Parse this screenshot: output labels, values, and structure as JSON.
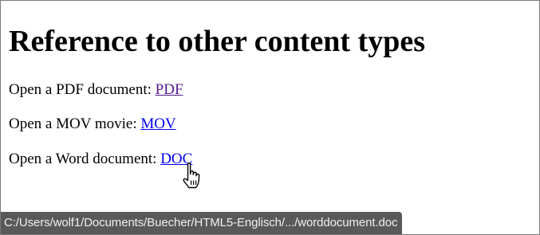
{
  "page": {
    "title": "Reference to other content types"
  },
  "links": [
    {
      "prefix": "Open a PDF document: ",
      "label": "PDF",
      "visited": true
    },
    {
      "prefix": "Open a MOV movie: ",
      "label": "MOV",
      "visited": false
    },
    {
      "prefix": "Open a Word document: ",
      "label": "DOC",
      "visited": false,
      "hovered": true
    }
  ],
  "status_bar": {
    "url": "C:/Users/wolf1/Documents/Buecher/HTML5-Englisch/.../worddocument.doc"
  },
  "cursor": {
    "icon": "hand-pointer-icon"
  }
}
